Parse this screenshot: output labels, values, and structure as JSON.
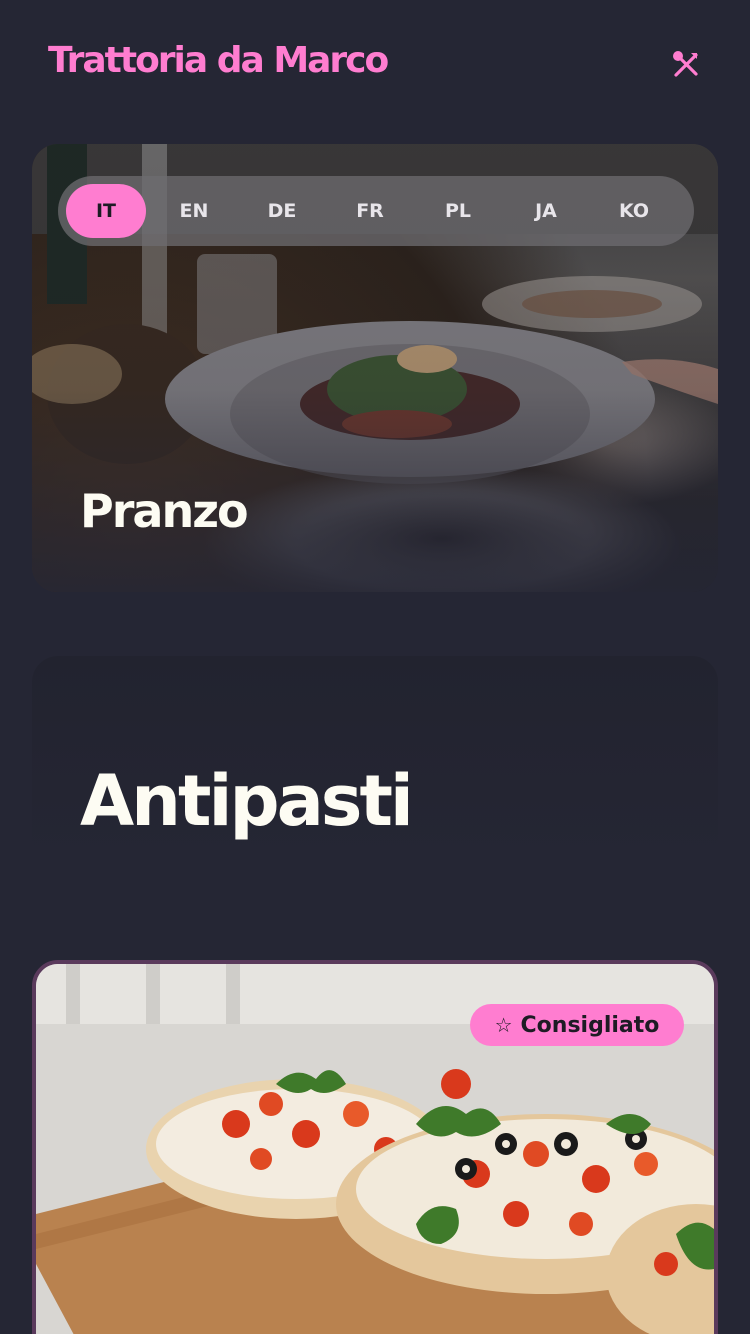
{
  "header": {
    "brand": "Trattoria da Marco",
    "menu_icon": "fork-knife-icon"
  },
  "languages": [
    {
      "code": "IT",
      "active": true
    },
    {
      "code": "EN",
      "active": false
    },
    {
      "code": "DE",
      "active": false
    },
    {
      "code": "FR",
      "active": false
    },
    {
      "code": "PL",
      "active": false
    },
    {
      "code": "JA",
      "active": false
    },
    {
      "code": "KO",
      "active": false
    }
  ],
  "hero": {
    "title": "Pranzo"
  },
  "section": {
    "title": "Antipasti"
  },
  "dish": {
    "badge": "Consigliato",
    "badge_icon": "star-icon"
  },
  "colors": {
    "accent": "#ff7dd0",
    "background": "#252634",
    "text": "#fdfcf3"
  }
}
